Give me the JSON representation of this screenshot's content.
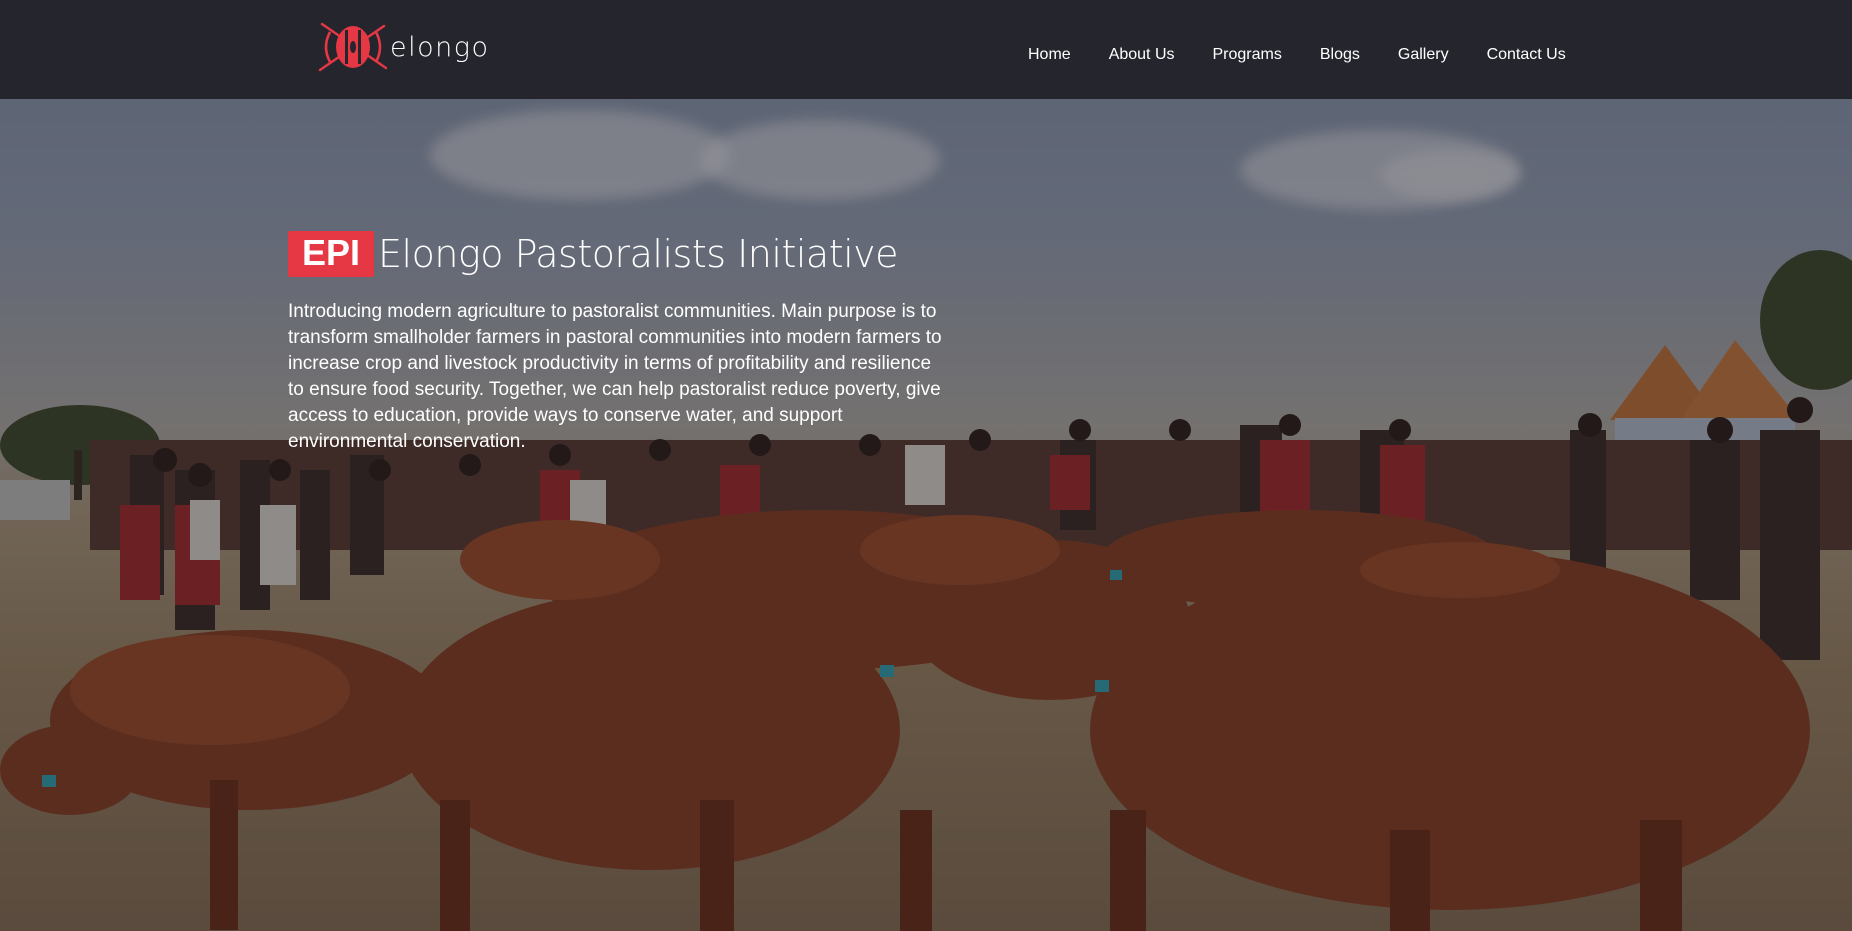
{
  "brand": {
    "name": "elongo",
    "accent_color": "#e53744",
    "logo_icon": "elongo-shield-icon"
  },
  "nav": {
    "items": [
      {
        "label": "Home"
      },
      {
        "label": "About Us"
      },
      {
        "label": "Programs"
      },
      {
        "label": "Blogs"
      },
      {
        "label": "Gallery"
      },
      {
        "label": "Contact Us"
      }
    ]
  },
  "hero": {
    "badge": "EPI",
    "title": "Elongo Pastoralists Initiative",
    "description": "Introducing modern agriculture to pastoralist communities. Main purpose is to transform smallholder farmers in pastoral communities into modern farmers to increase crop and livestock productivity in terms of profitability and resilience to ensure food security. Together, we can help pastoralist reduce poverty, give access to education, provide ways to conserve water, and support environmental conservation."
  },
  "colors": {
    "navbar_bg": "#25262d",
    "text": "#ffffff"
  }
}
